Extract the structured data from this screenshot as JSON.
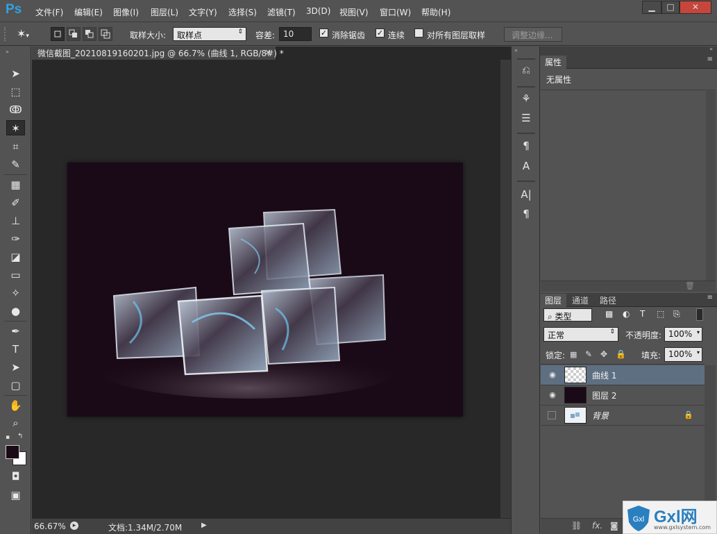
{
  "app": {
    "logo": "Ps"
  },
  "menu": [
    "文件(F)",
    "编辑(E)",
    "图像(I)",
    "图层(L)",
    "文字(Y)",
    "选择(S)",
    "滤镜(T)",
    "3D(D)",
    "视图(V)",
    "窗口(W)",
    "帮助(H)"
  ],
  "window_controls": {
    "minimize": "▁",
    "maximize": "□",
    "close": "✕"
  },
  "options": {
    "sample_size_label": "取样大小:",
    "sample_size_value": "取样点",
    "tolerance_label": "容差:",
    "tolerance_value": "10",
    "antialias_label": "消除锯齿",
    "antialias_checked": true,
    "contiguous_label": "连续",
    "contiguous_checked": true,
    "sample_all_label": "对所有图层取样",
    "sample_all_checked": false,
    "refine_edge_label": "调整边缘..."
  },
  "document": {
    "tab_title": "微信截图_20210819160201.jpg @ 66.7% (曲线 1, RGB/8#) *",
    "tab_close": "×",
    "artboard_color": "#1a0a17"
  },
  "status": {
    "zoom": "66.67%",
    "doc_info": "文档:1.34M/2.70M"
  },
  "properties": {
    "tab": "属性",
    "content": "无属性"
  },
  "layers_panel": {
    "tabs": [
      "图层",
      "通道",
      "路径"
    ],
    "filter_label": "类型",
    "blend_mode": "正常",
    "opacity_label": "不透明度:",
    "opacity_value": "100%",
    "lock_label": "锁定:",
    "fill_label": "填充:",
    "fill_value": "100%",
    "layers": [
      {
        "name": "曲线 1",
        "visible": true,
        "selected": true
      },
      {
        "name": "图层 2",
        "visible": true,
        "selected": false
      },
      {
        "name": "背景",
        "visible": false,
        "selected": false,
        "locked": true
      }
    ],
    "footer_icons": [
      "link-icon",
      "fx-icon",
      "mask-icon"
    ]
  },
  "watermark": {
    "text": "Gxl网",
    "subtext": "www.gxlsystem.com"
  },
  "colors": {
    "ps_blue": "#2fa3e3",
    "selected_layer": "#5f6f82",
    "foreground": "#1a0a17",
    "background": "#ffffff"
  }
}
